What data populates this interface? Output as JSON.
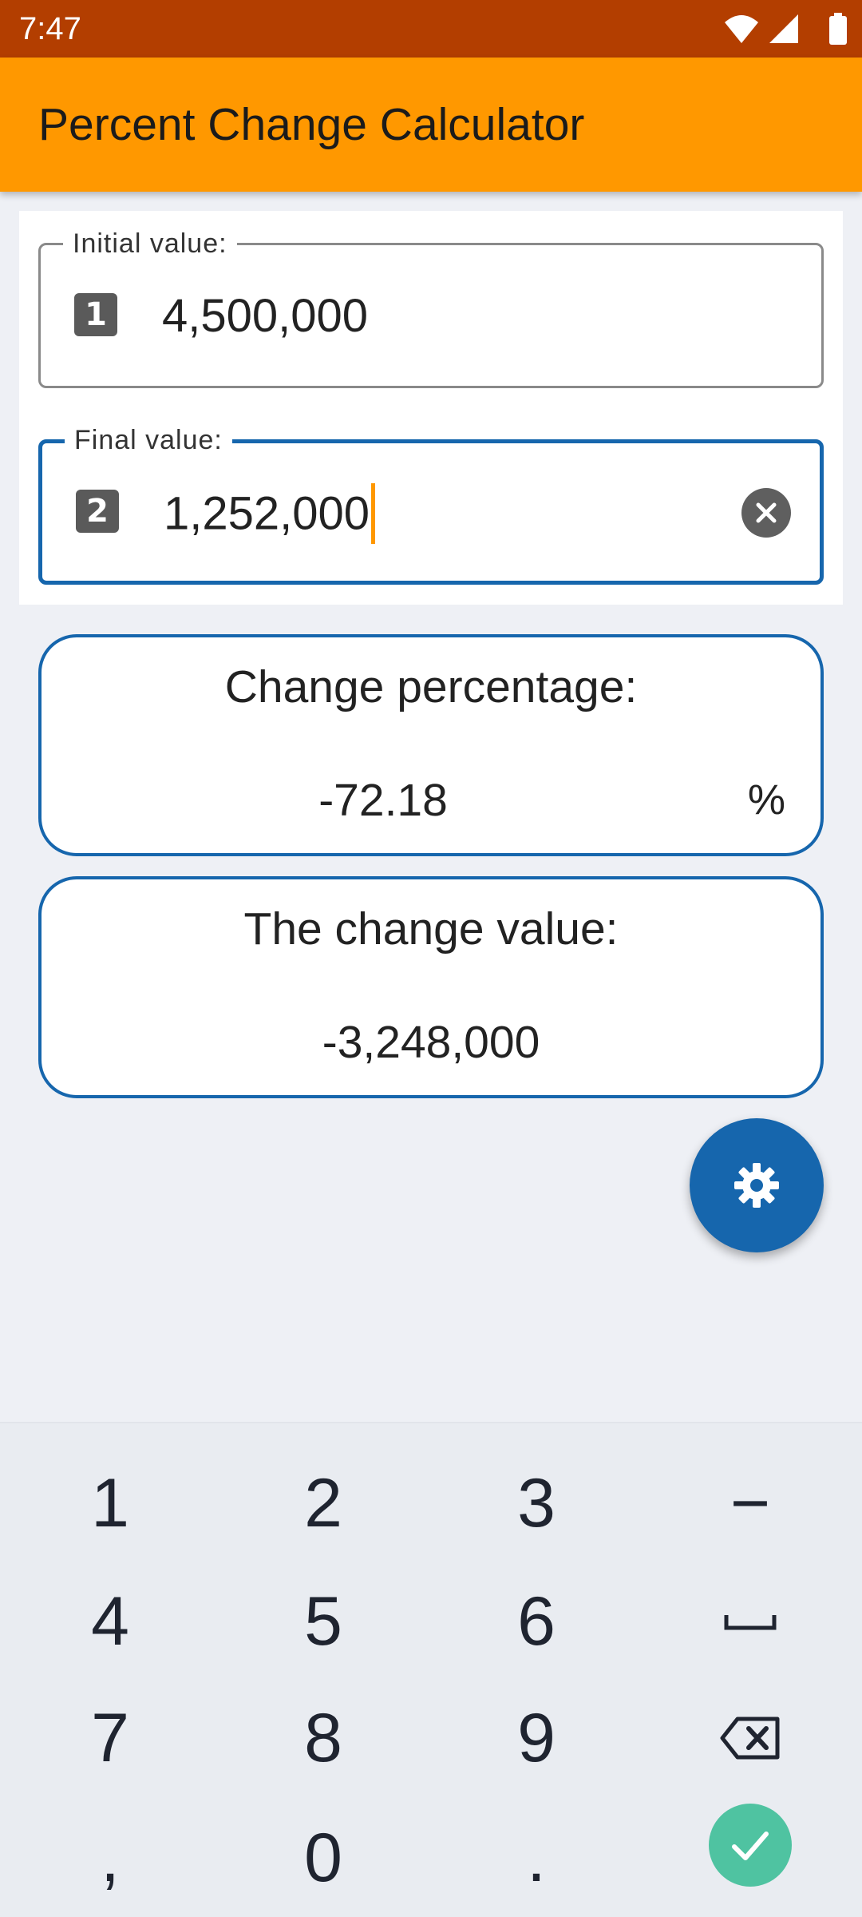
{
  "status_bar": {
    "time": "7:47",
    "icons": [
      "wifi-icon",
      "signal-icon",
      "battery-icon"
    ]
  },
  "app_bar": {
    "title": "Percent Change Calculator",
    "color": "#ff9800"
  },
  "inputs": {
    "initial": {
      "label": "Initial value:",
      "badge": "1",
      "value": "4,500,000"
    },
    "final": {
      "label": "Final value:",
      "badge": "2",
      "value": "1,252,000",
      "focused": true
    }
  },
  "results": {
    "percentage": {
      "title": "Change percentage:",
      "value": "-72.18",
      "unit": "%"
    },
    "change_value": {
      "title": "The change value:",
      "value": "-3,248,000"
    }
  },
  "fab": {
    "icon": "gear-icon"
  },
  "keypad": {
    "rows": [
      [
        "1",
        "2",
        "3",
        "−"
      ],
      [
        "4",
        "5",
        "6",
        "space"
      ],
      [
        "7",
        "8",
        "9",
        "backspace"
      ],
      [
        ",",
        "0",
        ".",
        "done"
      ]
    ],
    "labels": {
      "k1": "1",
      "k2": "2",
      "k3": "3",
      "minus": "−",
      "k4": "4",
      "k5": "5",
      "k6": "6",
      "k7": "7",
      "k8": "8",
      "k9": "9",
      "comma": ",",
      "k0": "0",
      "dot": "."
    }
  },
  "colors": {
    "status_bar": "#b33e00",
    "accent": "#ff9800",
    "primary": "#1666ad",
    "done": "#4fc3a1"
  }
}
